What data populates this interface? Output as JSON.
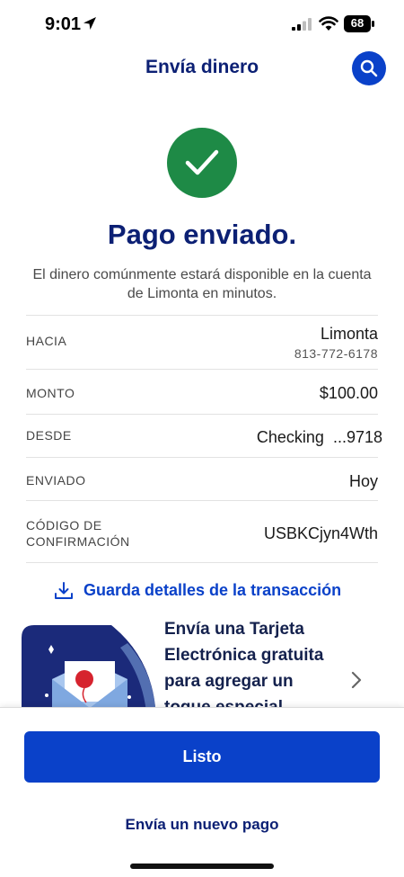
{
  "status": {
    "time": "9:01",
    "battery": "68"
  },
  "header": {
    "title": "Envía dinero",
    "search_icon": "search-icon"
  },
  "confirmation": {
    "headline": "Pago enviado.",
    "message": "El dinero comúnmente estará disponible en la cuenta de Limonta en minutos."
  },
  "details": {
    "to_label": "HACIA",
    "to_name": "Limonta",
    "to_phone": "813-772-6178",
    "amount_label": "MONTO",
    "amount_value": "$100.00",
    "from_label": "DESDE",
    "from_value": "Checking  ...9718",
    "sent_label": "ENVIADO",
    "sent_value": "Hoy",
    "code_label": "CÓDIGO DE CONFIRMACIÓN",
    "code_value": "USBKCjyn4Wth"
  },
  "save_link": "Guarda detalles de la transacción",
  "promo": {
    "text": "Envía una Tarjeta Electrónica gratuita para agregar un toque especial"
  },
  "actions": {
    "done": "Listo",
    "new_payment": "Envía un nuevo pago"
  },
  "colors": {
    "brand_blue": "#0a41c9",
    "title_navy": "#0c2074",
    "success_green": "#1e8a46"
  }
}
